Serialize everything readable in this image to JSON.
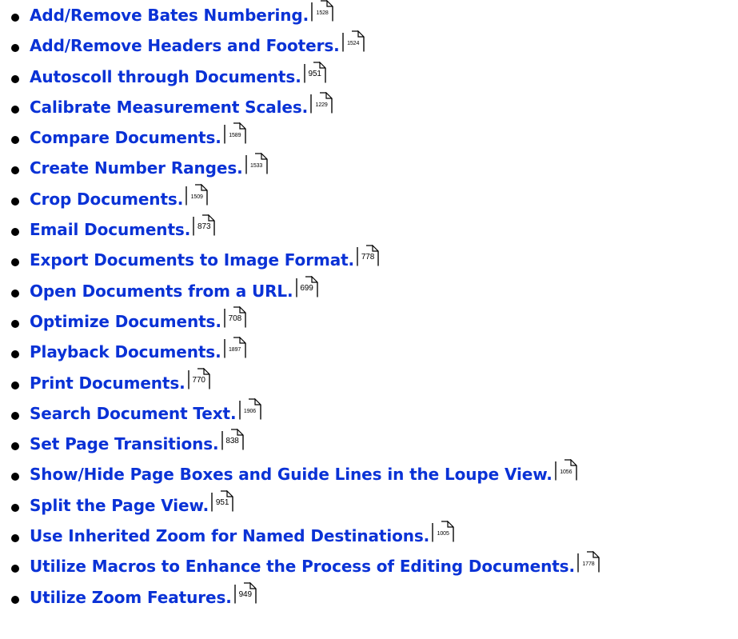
{
  "links": [
    {
      "label": "Add/Remove Bates Numbering.",
      "page": "1528"
    },
    {
      "label": "Add/Remove Headers and Footers.",
      "page": "1524"
    },
    {
      "label": "Autoscoll through Documents.",
      "page": "951"
    },
    {
      "label": "Calibrate Measurement Scales.",
      "page": "1229"
    },
    {
      "label": "Compare Documents.",
      "page": "1589"
    },
    {
      "label": "Create Number Ranges.",
      "page": "1533"
    },
    {
      "label": "Crop Documents.",
      "page": "1509"
    },
    {
      "label": "Email Documents.",
      "page": "873"
    },
    {
      "label": "Export Documents to Image Format.",
      "page": "778"
    },
    {
      "label": "Open Documents from a URL.",
      "page": "699"
    },
    {
      "label": "Optimize Documents.",
      "page": "708"
    },
    {
      "label": "Playback Documents.",
      "page": "1897"
    },
    {
      "label": "Print Documents.",
      "page": "770"
    },
    {
      "label": "Search Document Text.",
      "page": "1906"
    },
    {
      "label": "Set Page Transitions.",
      "page": "838"
    },
    {
      "label": "Show/Hide Page Boxes and Guide Lines in the Loupe View.",
      "page": "1056"
    },
    {
      "label": "Split the Page View.",
      "page": "951"
    },
    {
      "label": "Use Inherited Zoom for Named Destinations.",
      "page": "1005"
    },
    {
      "label": "Utilize Macros to Enhance the Process of Editing Documents.",
      "page": "1778"
    },
    {
      "label": "Utilize Zoom Features.",
      "page": "949"
    }
  ],
  "colors": {
    "link": "#0a32d6",
    "bullet": "#000000",
    "background": "#ffffff"
  },
  "icons": {
    "page_reference": "page-corner-icon"
  }
}
